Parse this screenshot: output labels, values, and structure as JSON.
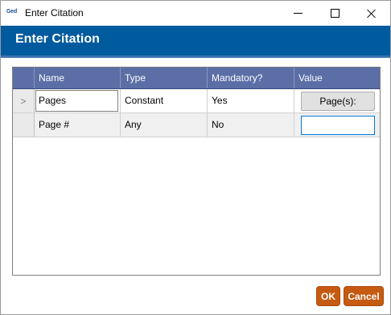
{
  "window": {
    "app_icon_text": "Ged",
    "title": "Enter Citation"
  },
  "banner": {
    "title": "Enter Citation",
    "background_color": "#005a9e"
  },
  "grid": {
    "columns": [
      "Name",
      "Type",
      "Mandatory?",
      "Value"
    ],
    "header_color": "#5b6ea6",
    "rows": [
      {
        "indicator": ">",
        "name": "Pages",
        "type": "Constant",
        "mandatory": "Yes",
        "value": "Page(s):"
      },
      {
        "indicator": "",
        "name": "Page #",
        "type": "Any",
        "mandatory": "No",
        "value": ""
      }
    ]
  },
  "footer": {
    "ok_label": "OK",
    "cancel_label": "Cancel",
    "button_color": "#c55a11"
  },
  "icons": {
    "minimize": "minimize-icon",
    "maximize": "maximize-icon",
    "close": "close-icon",
    "row_pointer": "chevron-right-icon"
  }
}
